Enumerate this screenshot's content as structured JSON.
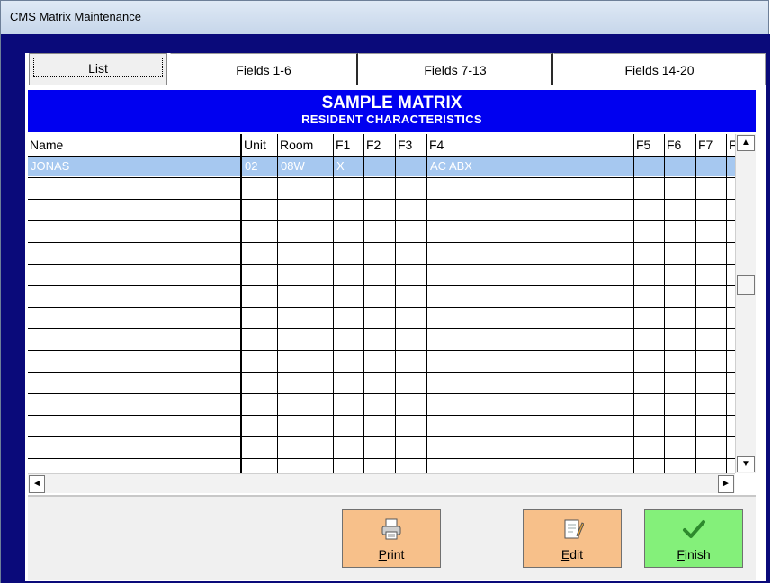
{
  "window": {
    "title": "CMS Matrix Maintenance"
  },
  "tabs": [
    "List",
    "Fields 1-6",
    "Fields 7-13",
    "Fields 14-20"
  ],
  "header": {
    "title": "SAMPLE MATRIX",
    "subtitle": "RESIDENT CHARACTERISTICS"
  },
  "grid": {
    "columns": [
      "Name",
      "Unit",
      "Room",
      "F1",
      "F2",
      "F3",
      "F4",
      "F5",
      "F6",
      "F7",
      "F"
    ],
    "rows": [
      {
        "name": "JONAS",
        "unit": "02",
        "room": "08W",
        "f1": "X",
        "f2": "",
        "f3": "",
        "f4": "AC ABX",
        "f5": "",
        "f6": "",
        "f7": ""
      }
    ]
  },
  "scroll": {
    "up": "▲",
    "down": "▼",
    "left": "◄",
    "right": "►"
  },
  "buttons": {
    "print": "Print",
    "edit": "Edit",
    "finish": "Finish"
  },
  "colors": {
    "header": "#0000f0",
    "frame": "#0a0a7a",
    "selection": "#a6c8f0",
    "action": "#f7c08a",
    "finish": "#84f07a"
  }
}
